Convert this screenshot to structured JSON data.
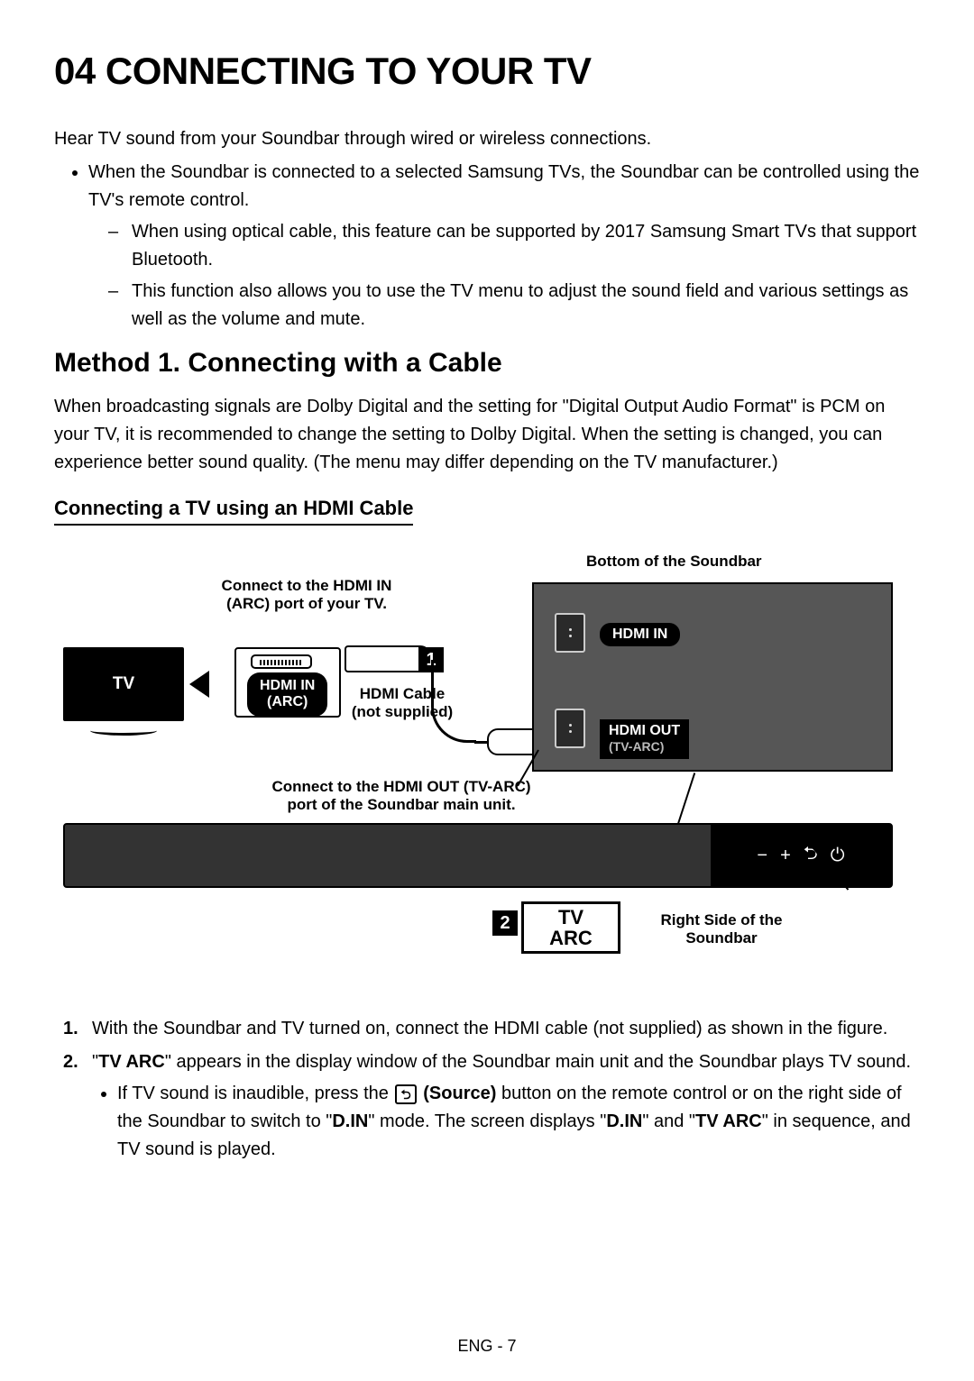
{
  "title": "04   CONNECTING TO YOUR TV",
  "intro": "Hear TV sound from your Soundbar through wired or wireless connections.",
  "bullet_main": "When the Soundbar is connected to a selected Samsung TVs, the Soundbar can be controlled using the TV's remote control.",
  "sub_dash_1": "When using optical cable, this feature can be supported by 2017 Samsung Smart TVs that support Bluetooth.",
  "sub_dash_2": "This function also allows you to use the TV menu to adjust the sound field and various settings as well as the volume and mute.",
  "method_heading": "Method 1. Connecting with a Cable",
  "method_para": "When broadcasting signals are Dolby Digital and the setting for \"Digital Output Audio Format\" is PCM on your TV, it is recommended to change the setting to Dolby Digital. When the setting is changed, you can experience better sound quality. (The menu may differ depending on the TV manufacturer.)",
  "h3": "Connecting a TV using an HDMI Cable",
  "diagram": {
    "bottom_label": "Bottom of the Soundbar",
    "connect_in": "Connect to the HDMI IN (ARC) port of your TV.",
    "tv_label": "TV",
    "hdmi_in_arc": "HDMI IN\n(ARC)",
    "hdmi_cable": "HDMI Cable",
    "not_supplied": "(not supplied)",
    "hdmi_in_badge": "HDMI IN",
    "hdmi_out_badge": "HDMI OUT",
    "hdmi_out_sub": "(TV-ARC)",
    "connect_out": "Connect to the HDMI OUT (TV-ARC) port of the Soundbar main unit.",
    "display_top": "TV",
    "display_bottom": "ARC",
    "right_side_label": "Right Side of the Soundbar",
    "side_icons": {
      "minus": "−",
      "plus": "+",
      "source": "⮌",
      "power": "⏻"
    },
    "num1": "1",
    "num2": "2"
  },
  "steps": {
    "s1_num": "1.",
    "s1": "With the Soundbar and TV turned on, connect the HDMI cable (not supplied) as shown in the figure.",
    "s2_num": "2.",
    "s2_pre_quote": "\"",
    "s2_tvarc": "TV ARC",
    "s2_rest": "\" appears in the display window of the Soundbar main unit and the Soundbar plays TV sound.",
    "s2_sub_pre": "If TV sound is inaudible, press the ",
    "source_label": "(Source)",
    "s2_sub_mid": " button on the remote control or on the right side of the Soundbar to switch to \"",
    "din": "D.IN",
    "s2_sub_mid2": "\" mode. The screen displays \"",
    "s2_sub_mid3": "\" and \"",
    "s2_sub_end": "\" in sequence, and TV sound is played."
  },
  "footer": "ENG - 7"
}
